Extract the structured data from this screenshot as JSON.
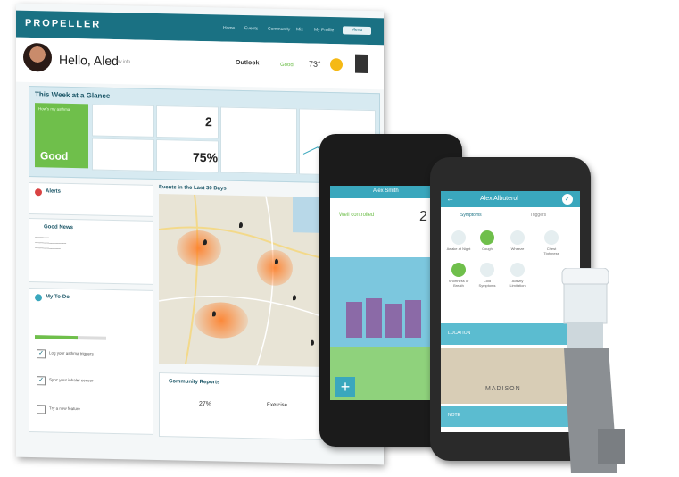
{
  "desktop": {
    "logo": "PROPELLER",
    "nav": [
      "Home",
      "Events",
      "Community",
      "Mix",
      "My Profile"
    ],
    "nav_button": "Menu",
    "greeting": "Hello, Aled",
    "greeting_sub": "my info",
    "outlook_label": "Outlook",
    "outlook_value": "Good",
    "temperature": "73°",
    "week": {
      "title": "This Week at a Glance",
      "status_label": "How's my asthma",
      "status": "Good",
      "rescue_count": "2",
      "percent": "75%"
    },
    "alerts_title": "Alerts",
    "good_news_title": "Good News",
    "events_title": "Events in the Last 30 Days",
    "todo_title": "My To-Do",
    "community_title": "Community Reports",
    "community_value": "27%",
    "community_label": "Exercise",
    "todo_items": [
      "Log your asthma triggers",
      "Sync your inhaler sensor",
      "Try a new feature"
    ]
  },
  "phone1": {
    "header": "Alex Smith",
    "status_title": "Well controlled",
    "count": "2",
    "plus_label": "+"
  },
  "phone2": {
    "header": "Alex Albuterol",
    "tab_symptoms": "Symptoms",
    "tab_triggers": "Triggers",
    "location_label": "LOCATION",
    "map_label": "MADISON",
    "notes_label": "NOTE",
    "symptoms": [
      "Awake at Night",
      "Cough",
      "Wheeze",
      "Chest Tightness",
      "Shortness of Breath",
      "Cold Symptoms",
      "Activity Limitation"
    ]
  },
  "colors": {
    "brand": "#1a7183",
    "good": "#6fbf4b",
    "phone_accent": "#3aa7bd"
  }
}
